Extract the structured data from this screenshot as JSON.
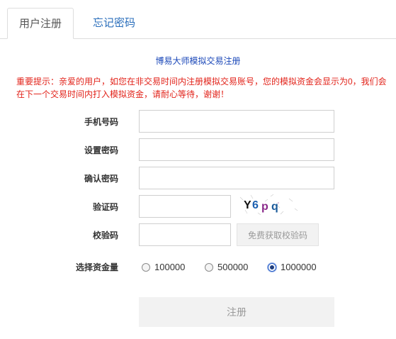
{
  "tabs": [
    {
      "label": "用户注册",
      "active": true
    },
    {
      "label": "忘记密码",
      "active": false
    }
  ],
  "form": {
    "title": "博易大师模拟交易注册",
    "notice": "重要提示：亲爱的用户，如您在非交易时间内注册模拟交易账号，您的模拟资金会显示为0，我们会在下一个交易时间内打入模拟资金，请耐心等待，谢谢！",
    "phone_label": "手机号码",
    "phone_value": "",
    "password_label": "设置密码",
    "password_value": "",
    "confirm_label": "确认密码",
    "confirm_value": "",
    "captcha_label": "验证码",
    "captcha_value": "",
    "captcha_text": "Y6pq",
    "sms_code_label": "校验码",
    "sms_code_value": "",
    "sms_button": "免费获取校验码",
    "funds_label": "选择资金量",
    "funds_options": [
      {
        "label": "100000",
        "selected": false
      },
      {
        "label": "500000",
        "selected": false
      },
      {
        "label": "1000000",
        "selected": true
      }
    ],
    "submit_label": "注册"
  },
  "colors": {
    "link_blue": "#2a6ebb",
    "title_blue": "#1a47b8",
    "notice_red": "#e2231a",
    "disabled_gray": "#999999"
  }
}
